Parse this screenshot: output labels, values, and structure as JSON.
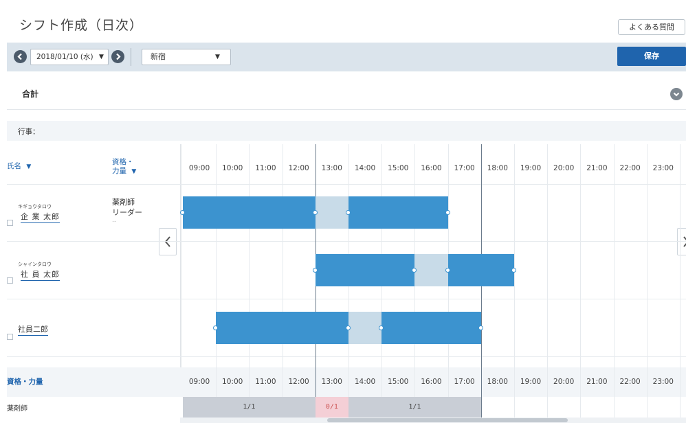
{
  "header": {
    "title": "シフト作成（日次）",
    "faq_label": "よくある質問"
  },
  "toolbar": {
    "prev_icon": "chevron-left-icon",
    "next_icon": "chevron-right-icon",
    "date_value": "2018/01/10 (水)",
    "location_value": "新宿",
    "save_label": "保存"
  },
  "totals": {
    "label": "合計"
  },
  "events": {
    "label": "行事："
  },
  "grid": {
    "name_header": "氏名",
    "qual_header_line1": "資格・",
    "qual_header_line2": "力量",
    "hours": [
      "09:00",
      "10:00",
      "11:00",
      "12:00",
      "13:00",
      "14:00",
      "15:00",
      "16:00",
      "17:00",
      "18:00",
      "19:00",
      "20:00",
      "21:00",
      "22:00",
      "23:00"
    ],
    "current_time_marker": "17:00",
    "employees": [
      {
        "kana": "キギョウタロウ",
        "name": "企 業 太郎",
        "qualification_line1": "薬剤師",
        "qualification_line2": "リーダー",
        "qualification_more": "..",
        "shift_start": "09:00",
        "shift_end": "17:00",
        "break_start": "13:00",
        "break_end": "14:00"
      },
      {
        "kana": "シャインタロウ",
        "name": "社 員 太郎",
        "qualification_line1": "",
        "qualification_line2": "",
        "qualification_more": "",
        "shift_start": "13:00",
        "shift_end": "19:00",
        "break_start": "16:00",
        "break_end": "17:00"
      },
      {
        "kana": "",
        "name": "社員二郎",
        "qualification_line1": "",
        "qualification_line2": "",
        "qualification_more": "",
        "shift_start": "10:00",
        "shift_end": "18:00",
        "break_start": "14:00",
        "break_end": "15:00"
      }
    ]
  },
  "summary": {
    "label": "資格・力量",
    "rows": [
      {
        "label": "薬剤師",
        "segments": [
          {
            "value": "1/1",
            "status": "ok"
          },
          {
            "value": "0/1",
            "status": "short"
          },
          {
            "value": "1/1",
            "status": "ok"
          }
        ]
      }
    ]
  }
}
